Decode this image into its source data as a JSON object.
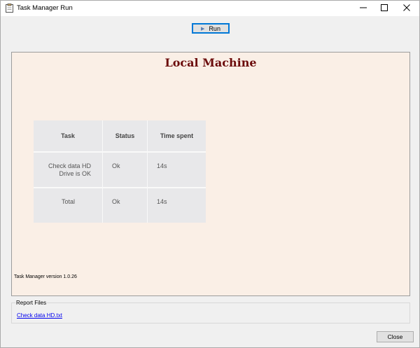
{
  "window": {
    "title": "Task Manager Run"
  },
  "toolbar": {
    "run_label": "Run"
  },
  "panel": {
    "title": "Local Machine",
    "table": {
      "headers": [
        "Task",
        "Status",
        "Time spent"
      ],
      "rows": [
        {
          "task_line1": "Check data HD",
          "task_line2": "Drive is OK",
          "status": "Ok",
          "time": "14s"
        },
        {
          "task": "Total",
          "status": "Ok",
          "time": "14s"
        }
      ]
    },
    "version": "Task Manager version 1.0.26"
  },
  "report_files": {
    "legend": "Report Files",
    "link": "Check data HD.txt"
  },
  "footer": {
    "close_label": "Close"
  },
  "colors": {
    "panel_background": "#faefe6",
    "title_color": "#6b0b0b",
    "table_background": "#e8e8ea",
    "link_color": "#0000ee",
    "accent_border": "#0078d7"
  }
}
